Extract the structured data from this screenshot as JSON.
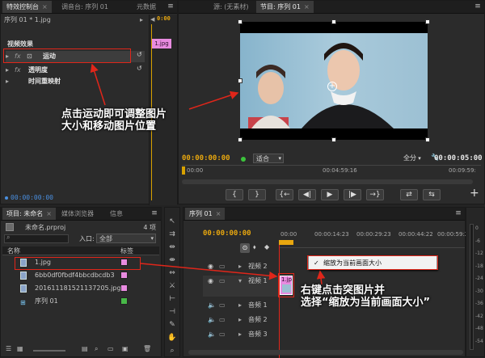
{
  "effect_controls": {
    "tabs": [
      {
        "label": "特效控制台",
        "active": true
      },
      {
        "label": "调音台: 序列 01",
        "active": false
      },
      {
        "label": "元数据",
        "active": false
      }
    ],
    "clip_path": "序列 01 * 1.jpg",
    "mini_clip_label": "1.jpg",
    "mini_timecode": "0:00",
    "section_title": "视频效果",
    "effects": [
      "运动",
      "透明度",
      "时间重映射"
    ],
    "bottom_timecode": "00:00:00:00"
  },
  "program_monitor": {
    "tabs": [
      {
        "label": "源: (无素材)",
        "active": false
      },
      {
        "label": "节目: 序列 01",
        "active": true
      }
    ],
    "timecode_current": "00:00:00:00",
    "fit_label": "适合",
    "quality_label": "全分",
    "timecode_duration": "00:00:05:00",
    "ruler": [
      "00:00",
      "00:04:59:16",
      "00:09:59:"
    ],
    "transport": [
      "{",
      "}",
      "{←",
      "◀|",
      "▶",
      "|▶",
      "→}",
      "⇄",
      "⇆"
    ]
  },
  "project": {
    "tabs": [
      {
        "label": "项目: 未命名",
        "active": true
      },
      {
        "label": "媒体浏览器",
        "active": false
      },
      {
        "label": "信息",
        "active": false
      }
    ],
    "file_name": "未命名.prproj",
    "item_count": "4 项",
    "in_label": "入口:",
    "in_value": "全部",
    "col_name": "名称",
    "col_label": "标签",
    "items": [
      {
        "name": "1.jpg",
        "color": "#e88be0",
        "type": "image"
      },
      {
        "name": "6bb0df0fbdf4bbcdbcdb3",
        "color": "#e88be0",
        "type": "image"
      },
      {
        "name": "201611181521137205.jpg",
        "color": "#e88be0",
        "type": "image"
      },
      {
        "name": "序列 01",
        "color": "#48b848",
        "type": "sequence"
      }
    ]
  },
  "timeline": {
    "tab": "序列 01",
    "timecode": "00:00:00:00",
    "ruler": [
      "00:00",
      "00:00:14:23",
      "00:00:29:23",
      "00:00:44:22",
      "00:00:59:22"
    ],
    "tracks": [
      {
        "label": "视频 2",
        "kind": "video"
      },
      {
        "label": "视频 1",
        "kind": "video"
      },
      {
        "label": "音频 1",
        "kind": "audio"
      },
      {
        "label": "音频 2",
        "kind": "audio"
      },
      {
        "label": "音频 3",
        "kind": "audio"
      }
    ],
    "clip_label": "1.jp",
    "context_menu_item": "缩放为当前画面大小",
    "level_labels": [
      "0",
      "-6",
      "-12",
      "-18",
      "-24",
      "-30",
      "-36",
      "-42",
      "-48",
      "-54"
    ]
  },
  "annotations": {
    "callout1_line1": "点击运动即可调整图片",
    "callout1_line2": "大小和移动图片位置",
    "callout2_line1": "右键点击突图片并",
    "callout2_line2": "选择“缩放为当前画面大小”"
  },
  "colors": {
    "timecode": "#e8a70f",
    "annotation_red": "#e0261a",
    "label_pink": "#e88be0",
    "label_green": "#48b848",
    "panel_bg": "#2b2b2b"
  }
}
